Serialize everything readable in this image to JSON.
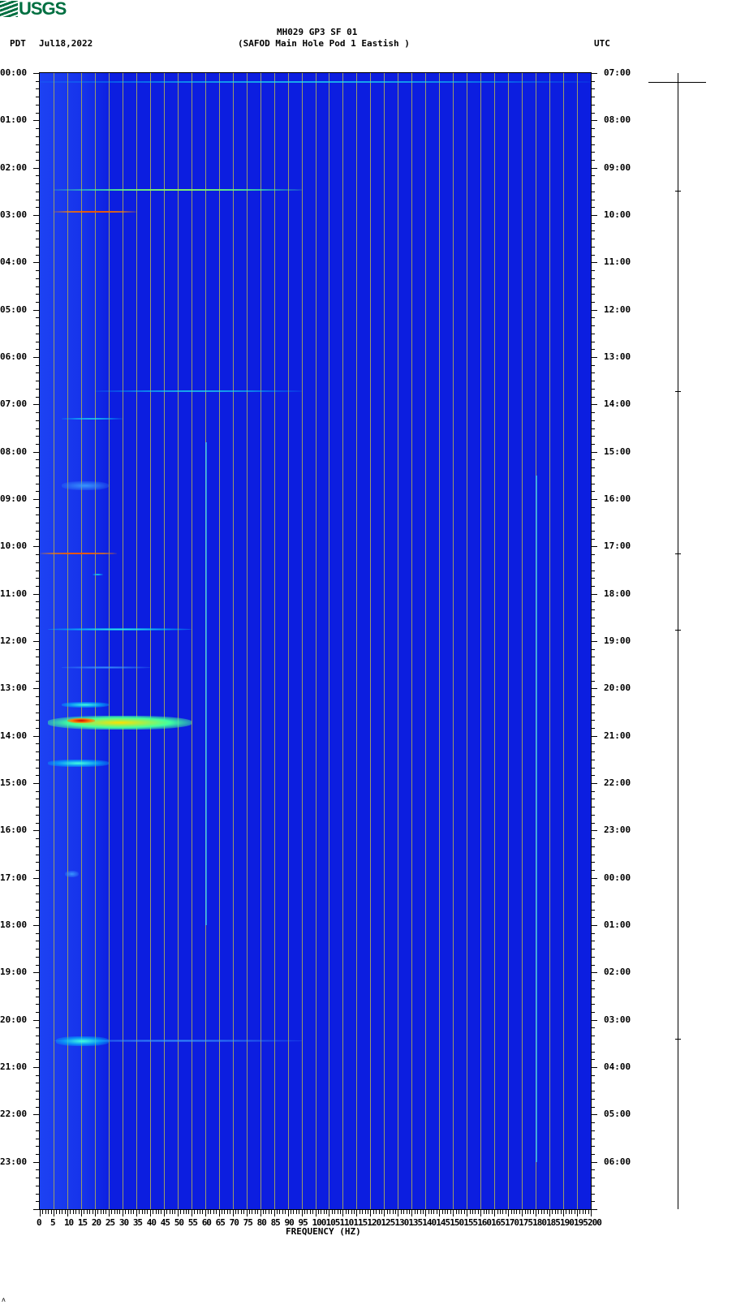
{
  "logo": "USGS",
  "header": {
    "title": "MH029 GP3 SF 01",
    "subtitle": "(SAFOD Main Hole Pod 1 Eastish )",
    "left_tz": "PDT",
    "date": "Jul18,2022",
    "right_tz": "UTC"
  },
  "footer_mark": "ʌ",
  "chart_data": {
    "type": "heatmap",
    "title": "MH029 GP3 SF 01 (SAFOD Main Hole Pod 1 Eastish )",
    "xlabel": "FREQUENCY (HZ)",
    "xlim": [
      0,
      200
    ],
    "ylim_hours": [
      0,
      24
    ],
    "x_ticks": [
      "0",
      "5",
      "10",
      "15",
      "20",
      "25",
      "30",
      "35",
      "40",
      "45",
      "50",
      "55",
      "60",
      "65",
      "70",
      "75",
      "80",
      "85",
      "90",
      "95",
      "100",
      "105",
      "110",
      "115",
      "120",
      "125",
      "130",
      "135",
      "140",
      "145",
      "150",
      "155",
      "160",
      "165",
      "170",
      "175",
      "180",
      "185",
      "190",
      "195",
      "200"
    ],
    "left_time_labels": [
      "00:00",
      "01:00",
      "02:00",
      "03:00",
      "04:00",
      "05:00",
      "06:00",
      "07:00",
      "08:00",
      "09:00",
      "10:00",
      "11:00",
      "12:00",
      "13:00",
      "14:00",
      "15:00",
      "16:00",
      "17:00",
      "18:00",
      "19:00",
      "20:00",
      "21:00",
      "22:00",
      "23:00"
    ],
    "right_time_labels": [
      "07:00",
      "08:00",
      "09:00",
      "10:00",
      "11:00",
      "12:00",
      "13:00",
      "14:00",
      "15:00",
      "16:00",
      "17:00",
      "18:00",
      "19:00",
      "20:00",
      "21:00",
      "22:00",
      "23:00",
      "00:00",
      "01:00",
      "02:00",
      "03:00",
      "04:00",
      "05:00",
      "06:00"
    ],
    "events": [
      {
        "hour": 0.18,
        "f0": 0,
        "f1": 200,
        "level": "cyan",
        "dur": 0.02
      },
      {
        "hour": 2.47,
        "f0": 5,
        "f1": 95,
        "level": "yellow",
        "dur": 0.03
      },
      {
        "hour": 2.93,
        "f0": 5,
        "f1": 35,
        "level": "red",
        "dur": 0.03
      },
      {
        "hour": 6.72,
        "f0": 20,
        "f1": 95,
        "level": "cyan",
        "dur": 0.03
      },
      {
        "hour": 7.3,
        "f0": 8,
        "f1": 30,
        "level": "cyan",
        "dur": 0.03
      },
      {
        "hour": 8.72,
        "f0": 8,
        "f1": 25,
        "level": "light",
        "dur": 0.2
      },
      {
        "hour": 10.15,
        "f0": 0,
        "f1": 28,
        "level": "red",
        "dur": 0.04
      },
      {
        "hour": 10.6,
        "f0": 19,
        "f1": 23,
        "level": "cyan",
        "dur": 0.04
      },
      {
        "hour": 11.75,
        "f0": 3,
        "f1": 55,
        "level": "cyan",
        "dur": 0.06
      },
      {
        "hour": 12.55,
        "f0": 8,
        "f1": 40,
        "level": "light",
        "dur": 0.05
      },
      {
        "hour": 13.35,
        "f0": 8,
        "f1": 25,
        "level": "cyan",
        "dur": 0.12
      },
      {
        "hour": 13.72,
        "f0": 3,
        "f1": 55,
        "level": "yellow",
        "dur": 0.3
      },
      {
        "hour": 13.68,
        "f0": 10,
        "f1": 20,
        "level": "red",
        "dur": 0.1
      },
      {
        "hour": 14.58,
        "f0": 3,
        "f1": 25,
        "level": "cyan",
        "dur": 0.15
      },
      {
        "hour": 16.92,
        "f0": 9,
        "f1": 14,
        "level": "light",
        "dur": 0.15
      },
      {
        "hour": 20.45,
        "f0": 5,
        "f1": 95,
        "level": "light",
        "dur": 0.05
      },
      {
        "hour": 20.45,
        "f0": 6,
        "f1": 25,
        "level": "cyan",
        "dur": 0.2
      }
    ],
    "vertical_lines": [
      {
        "freq": 180,
        "h0": 8.5,
        "h1": 23
      },
      {
        "freq": 60,
        "h0": 7.8,
        "h1": 18
      }
    ]
  }
}
